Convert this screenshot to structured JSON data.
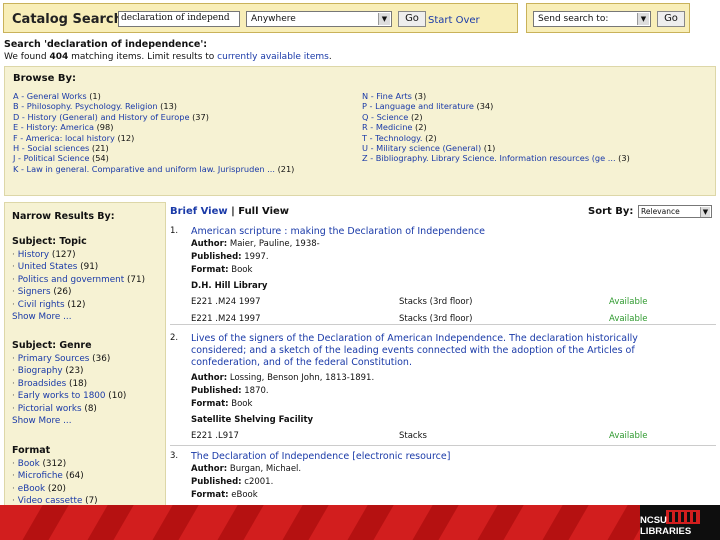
{
  "search": {
    "catalog_label": "Catalog Search:",
    "query": "declaration of independ",
    "scope": "Anywhere",
    "go_label": "Go",
    "start_over": "Start Over",
    "send_placeholder": "Send search to:",
    "send_go": "Go"
  },
  "summary": {
    "title": "Search 'declaration of independence':",
    "prefix": "We found ",
    "count": "404",
    "middle": " matching items. Limit results to ",
    "limit_link": "currently available items",
    "suffix": "."
  },
  "browse": {
    "title": "Browse By:",
    "left": [
      {
        "label": "A - General Works",
        "count": " (1)"
      },
      {
        "label": "B - Philosophy. Psychology. Religion",
        "count": " (13)"
      },
      {
        "label": "D - History (General) and History of Europe",
        "count": " (37)"
      },
      {
        "label": "E - History: America",
        "count": " (98)"
      },
      {
        "label": "F - America: local history",
        "count": " (12)"
      },
      {
        "label": "H - Social sciences",
        "count": " (21)"
      },
      {
        "label": "J - Political Science",
        "count": " (54)"
      },
      {
        "label": "K - Law in general. Comparative and uniform law. Jurispruden ...",
        "count": " (21)"
      }
    ],
    "right": [
      {
        "label": "N - Fine Arts",
        "count": " (3)"
      },
      {
        "label": "P - Language and literature",
        "count": " (34)"
      },
      {
        "label": "Q - Science",
        "count": " (2)"
      },
      {
        "label": "R - Medicine",
        "count": " (2)"
      },
      {
        "label": "T - Technology.",
        "count": " (2)"
      },
      {
        "label": "U - Military science (General)",
        "count": " (1)"
      },
      {
        "label": "Z - Bibliography. Library Science. Information resources (ge ...",
        "count": " (3)"
      }
    ]
  },
  "narrow": {
    "title": "Narrow Results By:",
    "groups": [
      {
        "heading": "Subject: Topic",
        "items": [
          {
            "label": "History",
            "count": " (127)"
          },
          {
            "label": "United States",
            "count": " (91)"
          },
          {
            "label": "Politics and government",
            "count": " (71)"
          },
          {
            "label": "Signers",
            "count": " (26)"
          },
          {
            "label": "Civil rights",
            "count": " (12)"
          }
        ],
        "more": "Show More ..."
      },
      {
        "heading": "Subject: Genre",
        "items": [
          {
            "label": "Primary Sources",
            "count": " (36)"
          },
          {
            "label": "Biography",
            "count": " (23)"
          },
          {
            "label": "Broadsides",
            "count": " (18)"
          },
          {
            "label": "Early works to 1800",
            "count": " (10)"
          },
          {
            "label": "Pictorial works",
            "count": " (8)"
          }
        ],
        "more": "Show More ..."
      },
      {
        "heading": "Format",
        "items": [
          {
            "label": "Book",
            "count": " (312)"
          },
          {
            "label": "Microfiche",
            "count": " (64)"
          },
          {
            "label": "eBook",
            "count": " (20)"
          },
          {
            "label": "Video cassette",
            "count": " (7)"
          }
        ],
        "more": ""
      }
    ]
  },
  "results": {
    "brief_view": "Brief View",
    "separator": " | ",
    "full_view": "Full View",
    "sort_label": "Sort By:",
    "sort_value": "Relevance",
    "items": [
      {
        "num": "1.",
        "title": "American scripture : making the Declaration of Independence",
        "author_label": "Author:",
        "author": " Maier, Pauline, 1938-",
        "published_label": "Published:",
        "published": " 1997.",
        "format_label": "Format:",
        "format": " Book",
        "library": "D.H. Hill Library",
        "holdings": [
          {
            "call": "E221 .M24 1997",
            "loc": "Stacks (3rd floor)",
            "status": "Available"
          },
          {
            "call": "E221 .M24 1997",
            "loc": "Stacks (3rd floor)",
            "status": "Available"
          }
        ]
      },
      {
        "num": "2.",
        "title": "Lives of the signers of the Declaration of American Independence. The declaration historically considered; and a sketch of the leading events connected with the adoption of the Articles of confederation, and of the federal Constitution.",
        "author_label": "Author:",
        "author": " Lossing, Benson John, 1813-1891.",
        "published_label": "Published:",
        "published": " 1870.",
        "format_label": "Format:",
        "format": " Book",
        "library": "Satellite Shelving Facility",
        "holdings": [
          {
            "call": "E221 .L917",
            "loc": "Stacks",
            "status": "Available"
          }
        ]
      },
      {
        "num": "3.",
        "title": "The Declaration of Independence [electronic resource]",
        "author_label": "Author:",
        "author": " Burgan, Michael.",
        "published_label": "Published:",
        "published": " c2001.",
        "format_label": "Format:",
        "format": " eBook"
      }
    ]
  },
  "footer": {
    "brand": "NCSU LIBRARIES",
    "brand_color": "#d21e1e"
  }
}
